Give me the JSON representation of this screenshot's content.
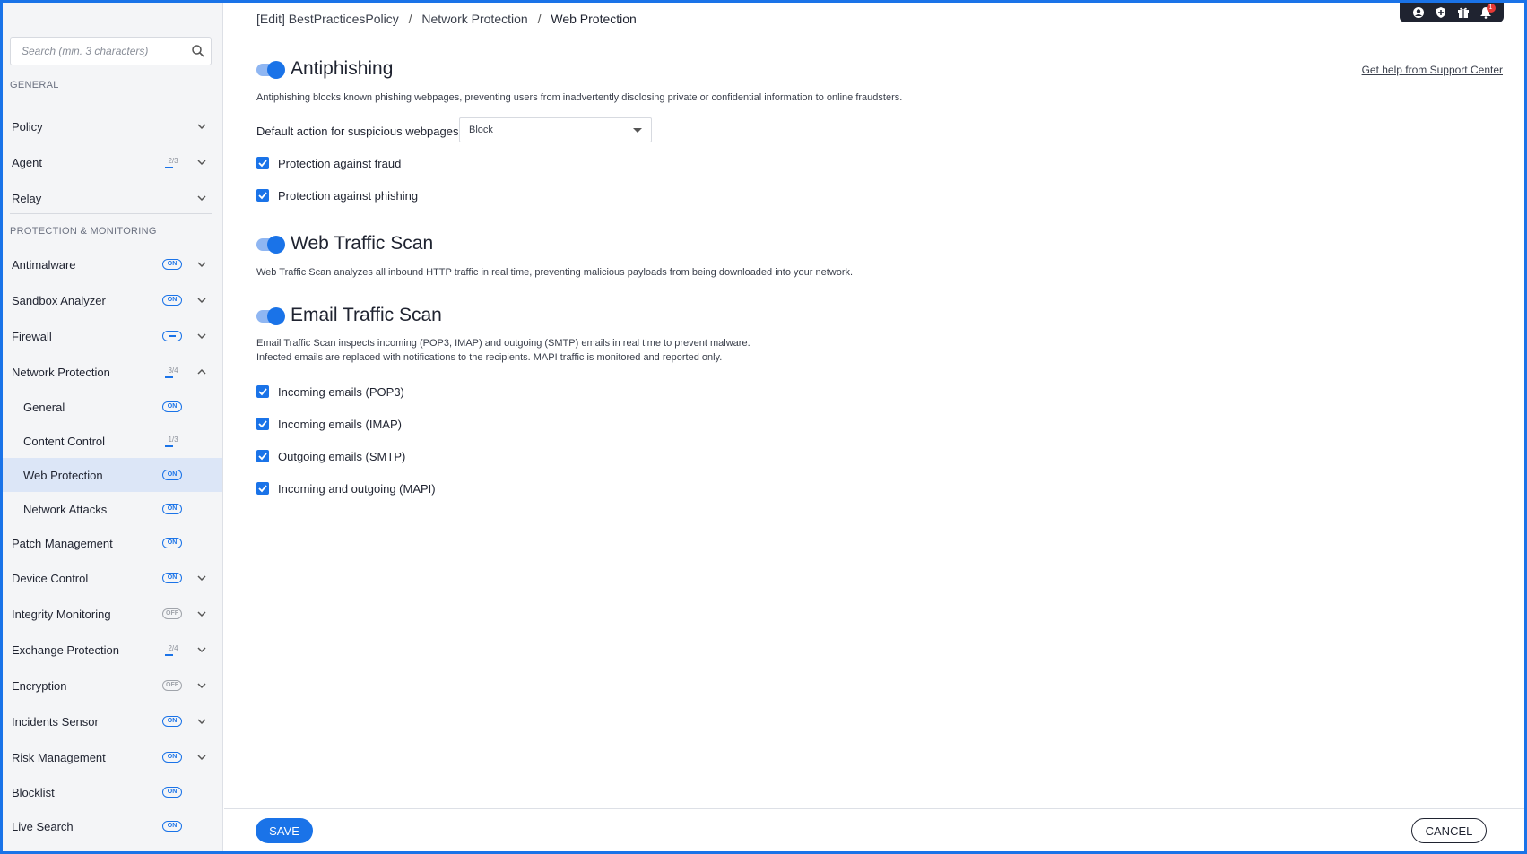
{
  "sidebar": {
    "search_placeholder": "Search (min. 3 characters)",
    "sections": {
      "general": "GENERAL",
      "protection": "PROTECTION & MONITORING"
    },
    "items": {
      "policy": "Policy",
      "agent": "Agent",
      "agent_badge": "2/3",
      "relay": "Relay",
      "antimalware": "Antimalware",
      "sandbox": "Sandbox Analyzer",
      "firewall": "Firewall",
      "network_protection": "Network Protection",
      "network_protection_badge": "3/4",
      "general_sub": "General",
      "content_control": "Content Control",
      "content_control_badge": "1/3",
      "web_protection": "Web Protection",
      "network_attacks": "Network Attacks",
      "patch_management": "Patch Management",
      "device_control": "Device Control",
      "integrity_monitoring": "Integrity Monitoring",
      "exchange_protection": "Exchange Protection",
      "exchange_protection_badge": "2/4",
      "encryption": "Encryption",
      "incidents_sensor": "Incidents Sensor",
      "risk_management": "Risk Management",
      "blocklist": "Blocklist",
      "live_search": "Live Search"
    },
    "badge_on": "ON",
    "badge_off": "OFF"
  },
  "topbar": {
    "notification_count": "1"
  },
  "breadcrumb": {
    "part1": "[Edit] BestPracticesPolicy",
    "sep": "/",
    "part2": "Network Protection",
    "part3": "Web Protection"
  },
  "help_link": "Get help from Support Center",
  "antiphishing": {
    "title": "Antiphishing",
    "description": "Antiphishing blocks known phishing webpages, preventing users from inadvertently disclosing private or confidential information to online fraudsters.",
    "default_action_label": "Default action for suspicious webpages:",
    "default_action_value": "Block",
    "checks": [
      "Protection against fraud",
      "Protection against phishing"
    ]
  },
  "web_traffic": {
    "title": "Web Traffic Scan",
    "description": "Web Traffic Scan analyzes all inbound HTTP traffic in real time, preventing malicious payloads from being downloaded into your network."
  },
  "email_traffic": {
    "title": "Email Traffic Scan",
    "description_1": "Email Traffic Scan inspects incoming (POP3, IMAP) and outgoing (SMTP) emails in real time to prevent malware.",
    "description_2": "Infected emails are replaced with notifications to the recipients. MAPI traffic is monitored and reported only.",
    "checks": [
      "Incoming emails (POP3)",
      "Incoming emails (IMAP)",
      "Outgoing emails (SMTP)",
      "Incoming and outgoing (MAPI)"
    ]
  },
  "footer": {
    "save": "SAVE",
    "cancel": "CANCEL"
  },
  "colors": {
    "accent": "#1a73e8",
    "active_item_bg": "#dce6f7"
  }
}
